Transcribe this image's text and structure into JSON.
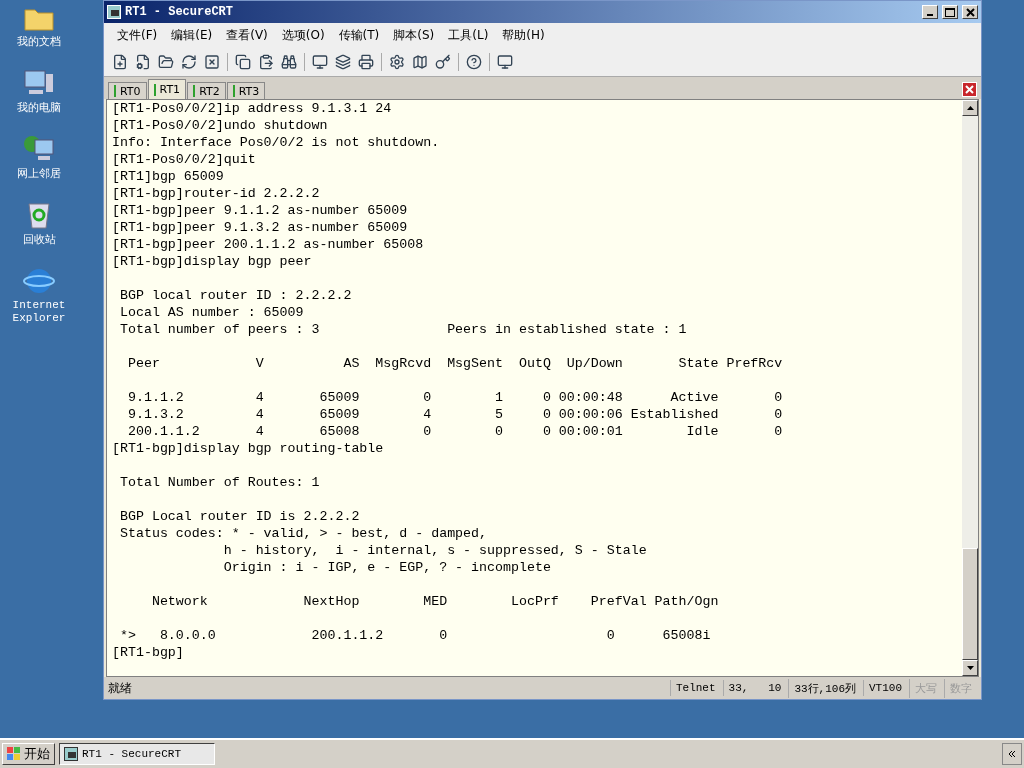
{
  "desktop_icons": [
    {
      "label": "我的文档",
      "kind": "folder"
    },
    {
      "label": "我的电脑",
      "kind": "computer"
    },
    {
      "label": "网上邻居",
      "kind": "network"
    },
    {
      "label": "回收站",
      "kind": "bin"
    },
    {
      "label": "Internet Explorer",
      "kind": "browser"
    }
  ],
  "window": {
    "title": "RT1 - SecureCRT"
  },
  "menu": [
    "文件(F)",
    "编辑(E)",
    "查看(V)",
    "选项(O)",
    "传输(T)",
    "脚本(S)",
    "工具(L)",
    "帮助(H)"
  ],
  "tabs": [
    {
      "label": "RT0",
      "selected": false
    },
    {
      "label": "RT1",
      "selected": true
    },
    {
      "label": "RT2",
      "selected": false
    },
    {
      "label": "RT3",
      "selected": false
    }
  ],
  "terminal_lines": [
    {
      "text": "[RT1-Pos0/0/2]ip address 9.1.3.1 24",
      "blank_before": false
    },
    {
      "text": "[RT1-Pos0/0/2]undo shutdown",
      "blank_before": false
    },
    {
      "text": "Info: Interface Pos0/0/2 is not shutdown.",
      "blank_before": false
    },
    {
      "text": "[RT1-Pos0/0/2]quit",
      "blank_before": false
    },
    {
      "text": "[RT1]bgp 65009",
      "blank_before": false
    },
    {
      "text": "[RT1-bgp]router-id 2.2.2.2",
      "blank_before": false
    },
    {
      "text": "[RT1-bgp]peer 9.1.1.2 as-number 65009",
      "blank_before": false
    },
    {
      "text": "[RT1-bgp]peer 9.1.3.2 as-number 65009",
      "blank_before": false
    },
    {
      "text": "[RT1-bgp]peer 200.1.1.2 as-number 65008",
      "blank_before": false
    },
    {
      "text": "[RT1-bgp]display bgp peer",
      "blank_before": false
    },
    {
      "text": " BGP local router ID : 2.2.2.2",
      "blank_before": true
    },
    {
      "text": " Local AS number : 65009",
      "blank_before": false
    },
    {
      "text": " Total number of peers : 3                Peers in established state : 1",
      "blank_before": false
    },
    {
      "text": "  Peer            V          AS  MsgRcvd  MsgSent  OutQ  Up/Down       State PrefRcv",
      "blank_before": true
    },
    {
      "text": "  9.1.1.2         4       65009        0        1     0 00:00:48      Active       0",
      "blank_before": true
    },
    {
      "text": "  9.1.3.2         4       65009        4        5     0 00:00:06 Established       0",
      "blank_before": false
    },
    {
      "text": "  200.1.1.2       4       65008        0        0     0 00:00:01        Idle       0",
      "blank_before": false
    },
    {
      "text": "[RT1-bgp]display bgp routing-table",
      "blank_before": false
    },
    {
      "text": " Total Number of Routes: 1",
      "blank_before": true
    },
    {
      "text": " BGP Local router ID is 2.2.2.2",
      "blank_before": true
    },
    {
      "text": " Status codes: * - valid, > - best, d - damped,",
      "blank_before": false
    },
    {
      "text": "              h - history,  i - internal, s - suppressed, S - Stale",
      "blank_before": false
    },
    {
      "text": "              Origin : i - IGP, e - EGP, ? - incomplete",
      "blank_before": false
    },
    {
      "text": "     Network            NextHop        MED        LocPrf    PrefVal Path/Ogn",
      "blank_before": true
    },
    {
      "text": " *>   8.0.0.0            200.1.1.2       0                    0      65008i",
      "blank_before": true
    },
    {
      "text": "[RT1-bgp]",
      "blank_before": false
    }
  ],
  "status_bar": {
    "message": "就绪",
    "fields": [
      {
        "text": "Telnet",
        "disabled": false
      },
      {
        "text": "33,   10",
        "disabled": false
      },
      {
        "text": "33行,106列",
        "disabled": false
      },
      {
        "text": "VT100",
        "disabled": false
      },
      {
        "text": "大写",
        "disabled": true
      },
      {
        "text": "数字",
        "disabled": true
      }
    ]
  },
  "taskbar": {
    "start": "开始",
    "tasks": [
      {
        "label": "RT1 - SecureCRT",
        "selected": true
      }
    ]
  }
}
